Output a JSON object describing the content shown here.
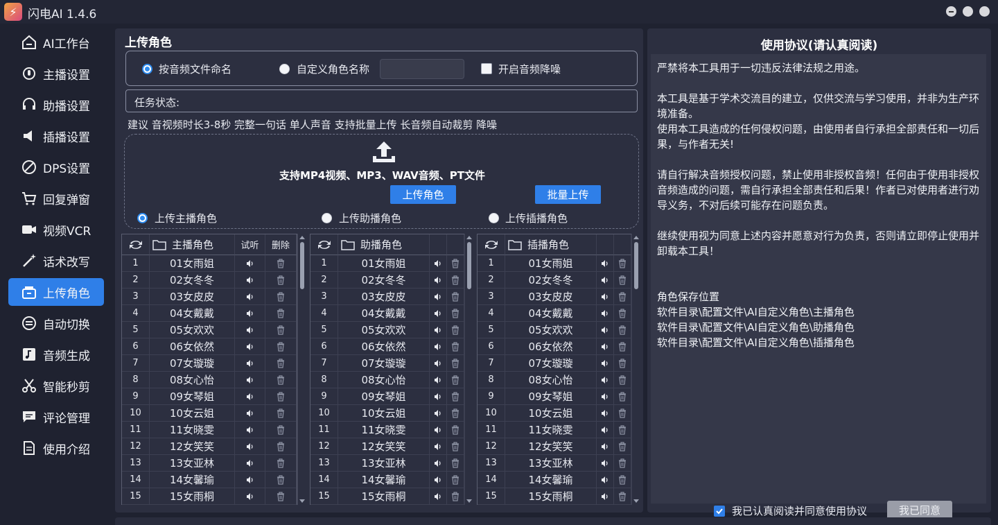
{
  "app": {
    "title": "闪电AI 1.4.6",
    "logo_char": "⚡"
  },
  "sidebar": {
    "items": [
      {
        "label": "AI工作台",
        "icon": "home-icon"
      },
      {
        "label": "主播设置",
        "icon": "mic-icon"
      },
      {
        "label": "助播设置",
        "icon": "headset-icon"
      },
      {
        "label": "插播设置",
        "icon": "speaker-icon"
      },
      {
        "label": "DPS设置",
        "icon": "gauge-icon"
      },
      {
        "label": "回复弹窗",
        "icon": "cart-icon"
      },
      {
        "label": "视频VCR",
        "icon": "video-icon"
      },
      {
        "label": "话术改写",
        "icon": "magic-icon"
      },
      {
        "label": "上传角色",
        "icon": "upload-box-icon",
        "active": true
      },
      {
        "label": "自动切换",
        "icon": "switch-icon"
      },
      {
        "label": "音频生成",
        "icon": "music-icon"
      },
      {
        "label": "智能秒剪",
        "icon": "scissors-icon"
      },
      {
        "label": "评论管理",
        "icon": "comment-icon"
      },
      {
        "label": "使用介绍",
        "icon": "doc-icon"
      }
    ]
  },
  "upload": {
    "section_title": "上传角色",
    "opt_by_file": "按音频文件命名",
    "opt_custom": "自定义角色名称",
    "custom_name_value": "",
    "opt_denoise": "开启音频降噪",
    "status_label": "任务状态:",
    "tip": "建议 音视频时长3-8秒 完整一句话 单人声音  支持批量上传 长音频自动裁剪 降噪",
    "support_text": "支持MP4视频、MP3、WAV音频、PT文件",
    "btn_upload": "上传角色",
    "btn_batch": "批量上传",
    "target_main": "上传主播角色",
    "target_assist": "上传助播角色",
    "target_insert": "上传插播角色"
  },
  "tables": {
    "main": {
      "header": "主播角色",
      "col_listen": "试听",
      "col_delete": "删除"
    },
    "assist": {
      "header": "助播角色"
    },
    "insert": {
      "header": "插播角色"
    },
    "rows": [
      {
        "no": "1",
        "name": "01女雨姐"
      },
      {
        "no": "2",
        "name": "02女冬冬"
      },
      {
        "no": "3",
        "name": "03女皮皮"
      },
      {
        "no": "4",
        "name": "04女戴戴"
      },
      {
        "no": "5",
        "name": "05女欢欢"
      },
      {
        "no": "6",
        "name": "06女依然"
      },
      {
        "no": "7",
        "name": "07女璇璇"
      },
      {
        "no": "8",
        "name": "08女心怡"
      },
      {
        "no": "9",
        "name": "09女琴姐"
      },
      {
        "no": "10",
        "name": "10女云姐"
      },
      {
        "no": "11",
        "name": "11女晓雯"
      },
      {
        "no": "12",
        "name": "12女笑笑"
      },
      {
        "no": "13",
        "name": "13女亚林"
      },
      {
        "no": "14",
        "name": "14女馨瑜"
      },
      {
        "no": "15",
        "name": "15女雨桐"
      }
    ]
  },
  "agreement": {
    "title": "使用协议(请认真阅读)",
    "paragraphs": [
      "严禁将本工具用于一切违反法律法规之用途。",
      "",
      "本工具是基于学术交流目的建立，仅供交流与学习使用，并非为生产环境准备。",
      "使用本工具造成的任何侵权问题，由使用者自行承担全部责任和一切后果，与作者无关!",
      "",
      "请自行解决音频授权问题，禁止使用非授权音频！任何由于使用非授权音频造成的问题，需自行承担全部责任和后果！作者已对使用者进行劝导义务，不对后续可能存在问题负责。",
      "",
      "继续使用视为同意上述内容并愿意对行为负责，否则请立即停止使用并卸载本工具！",
      "",
      "",
      "角色保存位置",
      "软件目录\\配置文件\\AI自定义角色\\主播角色",
      "软件目录\\配置文件\\AI自定义角色\\助播角色",
      "软件目录\\配置文件\\AI自定义角色\\插播角色"
    ],
    "check_label": "我已认真阅读并同意使用协议",
    "agree_btn": "我已同意"
  }
}
